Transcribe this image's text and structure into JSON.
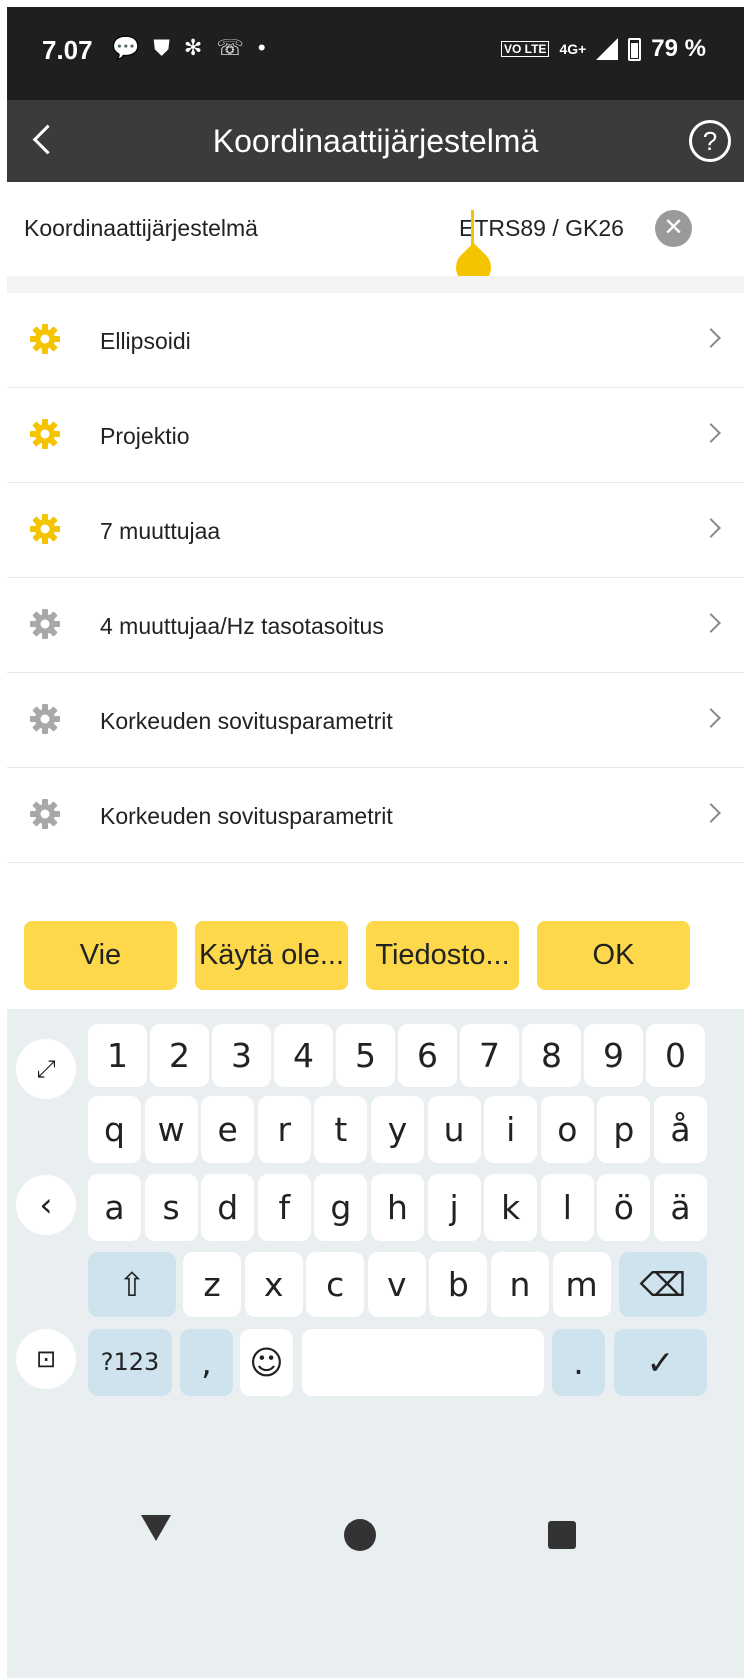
{
  "status_bar": {
    "time": "7.07",
    "icons": [
      "message-icon",
      "shield-icon",
      "gear-icon",
      "call-icon",
      "dot-icon"
    ],
    "volte": "VO LTE",
    "network": "4G+",
    "battery": "79 %"
  },
  "app_bar": {
    "title": "Koordinaattijärjestelmä",
    "help_label": "?"
  },
  "crs": {
    "label": "Koordinaattijärjestelmä",
    "value": "ETRS89 / GK26",
    "clear_label": "✕"
  },
  "items": [
    {
      "label": "Ellipsoidi",
      "active": true
    },
    {
      "label": "Projektio",
      "active": true
    },
    {
      "label": "7 muuttujaa",
      "active": true
    },
    {
      "label": "4 muuttujaa/Hz tasotasoitus",
      "active": false
    },
    {
      "label": "Korkeuden sovitusparametrit",
      "active": false
    },
    {
      "label": "Korkeuden sovitusparametrit",
      "active": false
    }
  ],
  "buttons": {
    "export": "Vie",
    "use_default": "Käytä ole...",
    "file": "Tiedosto...",
    "ok": "OK"
  },
  "keyboard": {
    "row_numbers": [
      "1",
      "2",
      "3",
      "4",
      "5",
      "6",
      "7",
      "8",
      "9",
      "0"
    ],
    "row1": [
      "q",
      "w",
      "e",
      "r",
      "t",
      "y",
      "u",
      "i",
      "o",
      "p",
      "å"
    ],
    "row2": [
      "a",
      "s",
      "d",
      "f",
      "g",
      "h",
      "j",
      "k",
      "l",
      "ö",
      "ä"
    ],
    "row3": [
      "z",
      "x",
      "c",
      "v",
      "b",
      "n",
      "m"
    ],
    "symbols": "?123",
    "comma": ",",
    "period": ".",
    "emoji": "☺",
    "check": "✓",
    "shift": "⇧",
    "backspace": "⌫"
  },
  "colors": {
    "accent": "#fcd84a",
    "gear_active": "#f5c400",
    "gear_inactive": "#a8a8a8",
    "appbar": "#3b3b3b",
    "statusbar": "#1f1f1f"
  }
}
